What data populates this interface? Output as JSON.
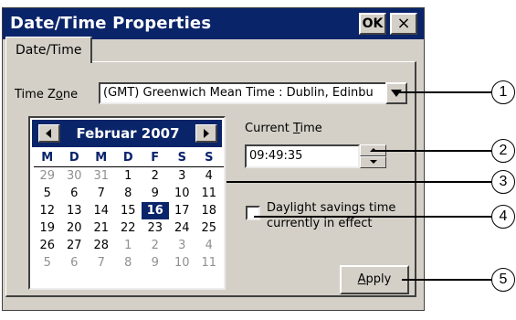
{
  "window": {
    "title": "Date/Time Properties",
    "ok_label": "OK",
    "close_label": "×"
  },
  "tabs": [
    {
      "label": "Date/Time",
      "active": true
    }
  ],
  "timezone": {
    "label_pre": "Time Z",
    "label_accel": "o",
    "label_post": "ne",
    "value": "(GMT) Greenwich Mean Time : Dublin, Edinbu"
  },
  "calendar": {
    "title": "Februar 2007",
    "weekdays": [
      "M",
      "D",
      "M",
      "D",
      "F",
      "S",
      "S"
    ],
    "weeks": [
      [
        [
          "29",
          "muted"
        ],
        [
          "30",
          "muted"
        ],
        [
          "31",
          "muted"
        ],
        [
          "1",
          ""
        ],
        [
          "2",
          ""
        ],
        [
          "3",
          ""
        ],
        [
          "4",
          ""
        ]
      ],
      [
        [
          "5",
          ""
        ],
        [
          "6",
          ""
        ],
        [
          "7",
          ""
        ],
        [
          "8",
          ""
        ],
        [
          "9",
          ""
        ],
        [
          "10",
          ""
        ],
        [
          "11",
          ""
        ]
      ],
      [
        [
          "12",
          ""
        ],
        [
          "13",
          ""
        ],
        [
          "14",
          ""
        ],
        [
          "15",
          ""
        ],
        [
          "16",
          "sel"
        ],
        [
          "17",
          ""
        ],
        [
          "18",
          ""
        ]
      ],
      [
        [
          "19",
          ""
        ],
        [
          "20",
          ""
        ],
        [
          "21",
          ""
        ],
        [
          "22",
          ""
        ],
        [
          "23",
          ""
        ],
        [
          "24",
          ""
        ],
        [
          "25",
          ""
        ]
      ],
      [
        [
          "26",
          ""
        ],
        [
          "27",
          ""
        ],
        [
          "28",
          ""
        ],
        [
          "1",
          "muted"
        ],
        [
          "2",
          "muted"
        ],
        [
          "3",
          "muted"
        ],
        [
          "4",
          "muted"
        ]
      ],
      [
        [
          "5",
          "muted"
        ],
        [
          "6",
          "muted"
        ],
        [
          "7",
          "muted"
        ],
        [
          "8",
          "muted"
        ],
        [
          "9",
          "muted"
        ],
        [
          "10",
          "muted"
        ],
        [
          "11",
          "muted"
        ]
      ]
    ]
  },
  "time": {
    "label_pre": "Current ",
    "label_accel": "T",
    "label_post": "ime",
    "value": "09:49:35"
  },
  "dst": {
    "label": "Daylight savings time currently in effect",
    "checked": false
  },
  "apply": {
    "accel": "A",
    "rest": "pply"
  },
  "callouts": [
    "1",
    "2",
    "3",
    "4",
    "5"
  ],
  "colors": {
    "titlebar": "#0a246a",
    "face": "#d4d0c8",
    "selected": "#0a246a"
  }
}
